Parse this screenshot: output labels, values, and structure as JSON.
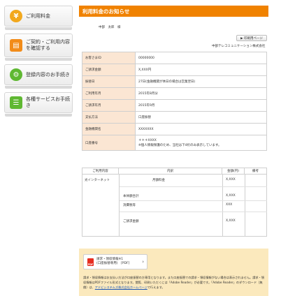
{
  "sidebar": {
    "items": [
      {
        "label": "ご利用料金",
        "icon": "yen-icon"
      },
      {
        "label": "ご契約・ご利用内容を確認する",
        "icon": "book-icon"
      },
      {
        "label": "登録内容のお手続き",
        "icon": "gear-icon"
      },
      {
        "label": "各種サービスお手続き",
        "icon": "list-icon"
      }
    ]
  },
  "header": {
    "title": "利用料金のお知らせ"
  },
  "addressee": "中部　太郎　様",
  "print_button": "▶ 印刷用ページ",
  "company": "中部テレコミュニケーション株式会社",
  "info": {
    "customer_id_label": "お客さまID",
    "customer_id": "00000000",
    "amount_label": "ご請求金額",
    "amount": "X,XXX円",
    "transfer_date_label": "振替日",
    "transfer_date": "27日(金融機関が休日の場合は営業翌日)",
    "usage_month_label": "ご利用年月",
    "usage_month": "2015年8月分",
    "billing_month_label": "ご請求年月",
    "billing_month": "2015年9月",
    "payment_label": "支払方法",
    "payment": "口座振替",
    "bank_label": "金融機関名",
    "bank": "XXXXXXX",
    "account_label": "口座番号",
    "account": "＊＊＊XXXX",
    "account_note": "※個人情報保護のため、当社は下4桁のみ表示しています。"
  },
  "detail": {
    "headers": [
      "ご利用内容",
      "内訳",
      "金額(円)",
      "備考"
    ],
    "service": "光インターネット",
    "monthly_fee": "月額料金",
    "monthly_amount": "X,XXX",
    "subtotal_label": "本体額合計",
    "subtotal": "X,XXX",
    "tax_label": "消費税等",
    "tax": "XXX",
    "total_label": "ご請求金額",
    "total": "X,XXX"
  },
  "notice": {
    "pdf_line1": "請求・領収情報※1",
    "pdf_line2": "(口座振替専用)　[PDF]",
    "text1": "請求・領収情報はお支払い方法が口座振替の方専用となります。また口座振替での請求・領収情報がない場合は表示されません。請求・領収情報はPDFファイル形式となります。閲覧、印刷いただくには「Adobe Reader」が必要です。「Adobe Reader」のダウンロード（無償）は、",
    "link": "アドビシステムズ株式会社ホームページ",
    "text2": "で行えます。"
  }
}
